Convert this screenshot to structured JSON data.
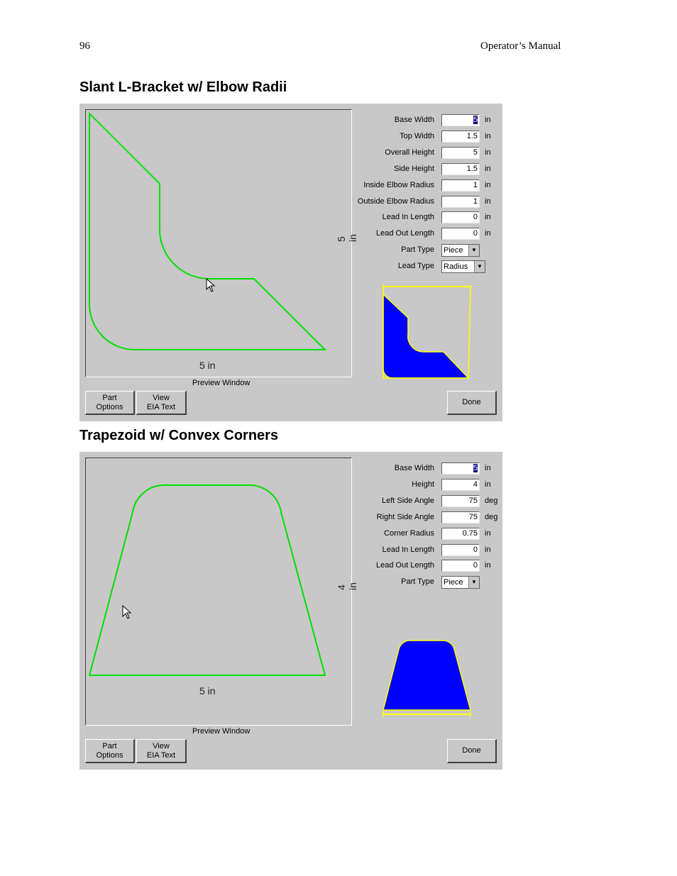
{
  "page": {
    "number": "96",
    "header": "Operator’s Manual"
  },
  "panel1": {
    "title": "Slant L-Bracket w/ Elbow Radii",
    "preview_label": "Preview Window",
    "dim_width": "5 in",
    "dim_height": "5 in",
    "fields": [
      {
        "label": "Base Width",
        "value": "5",
        "unit": "in",
        "selected": true
      },
      {
        "label": "Top Width",
        "value": "1.5",
        "unit": "in"
      },
      {
        "label": "Overall Height",
        "value": "5",
        "unit": "in"
      },
      {
        "label": "Side Height",
        "value": "1.5",
        "unit": "in"
      },
      {
        "label": "Inside Elbow Radius",
        "value": "1",
        "unit": "in"
      },
      {
        "label": "Outside Elbow Radius",
        "value": "1",
        "unit": "in"
      },
      {
        "label": "Lead In Length",
        "value": "0",
        "unit": "in"
      },
      {
        "label": "Lead Out Length",
        "value": "0",
        "unit": "in"
      }
    ],
    "part_type": {
      "label": "Part Type",
      "value": "Piece"
    },
    "lead_type": {
      "label": "Lead Type",
      "value": "Radius"
    },
    "buttons": {
      "part_options_1": "Part",
      "part_options_2": "Options",
      "view_eia_1": "View",
      "view_eia_2": "EIA Text",
      "done": "Done"
    }
  },
  "panel2": {
    "title": "Trapezoid w/ Convex Corners",
    "preview_label": "Preview Window",
    "dim_width": "5 in",
    "dim_height": "4 in",
    "fields": [
      {
        "label": "Base Width",
        "value": "5",
        "unit": "in",
        "selected": true
      },
      {
        "label": "Height",
        "value": "4",
        "unit": "in"
      },
      {
        "label": "Left Side Angle",
        "value": "75",
        "unit": "deg"
      },
      {
        "label": "Right Side Angle",
        "value": "75",
        "unit": "deg"
      },
      {
        "label": "Corner Radius",
        "value": "0.75",
        "unit": "in"
      },
      {
        "label": "Lead In Length",
        "value": "0",
        "unit": "in"
      },
      {
        "label": "Lead Out Length",
        "value": "0",
        "unit": "in"
      }
    ],
    "part_type": {
      "label": "Part Type",
      "value": "Piece"
    },
    "buttons": {
      "part_options_1": "Part",
      "part_options_2": "Options",
      "view_eia_1": "View",
      "view_eia_2": "EIA Text",
      "done": "Done"
    }
  },
  "colors": {
    "outline": "#00e000",
    "fill": "#0000ff",
    "thumb_border": "#ffff00",
    "panel": "#c8c8c8"
  }
}
